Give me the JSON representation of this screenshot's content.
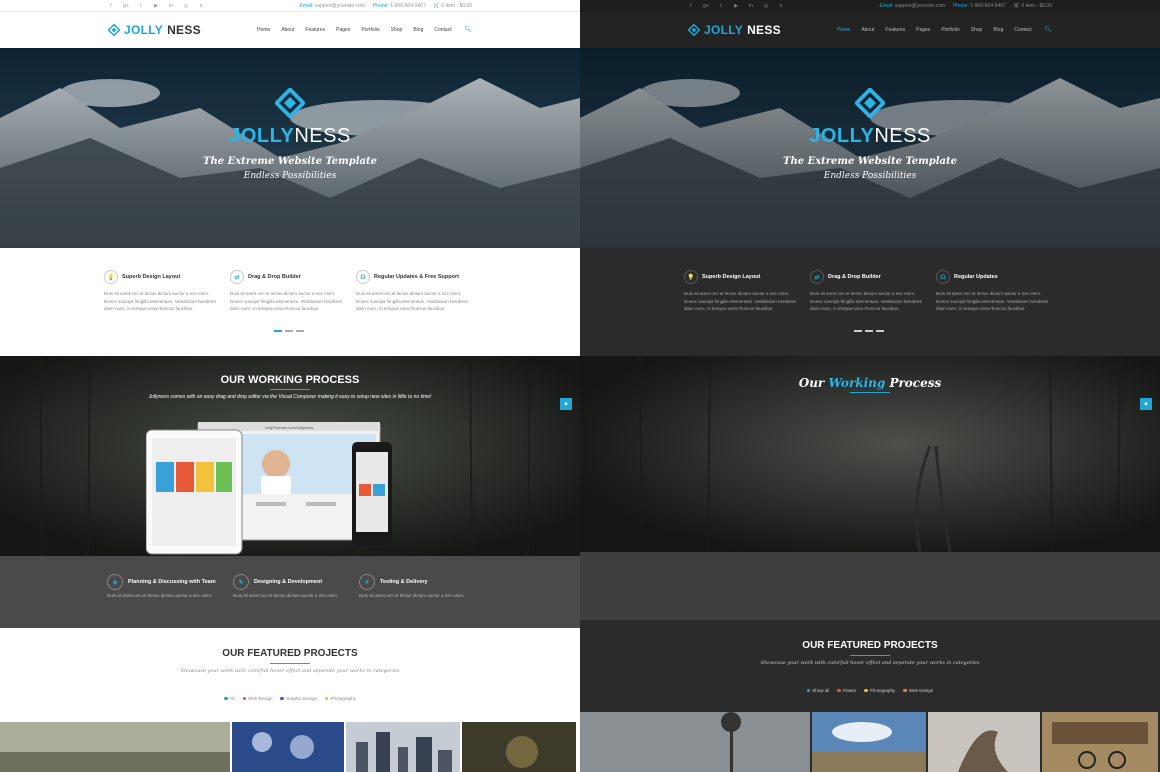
{
  "brand": {
    "part1": "JOLLY",
    "part2": "NESS"
  },
  "topbar": {
    "social_icons": [
      "facebook-icon",
      "google-plus-icon",
      "twitter-icon",
      "youtube-icon",
      "linkedin-icon",
      "instagram-icon",
      "skype-icon"
    ],
    "social_glyphs": [
      "f",
      "g+",
      "t",
      "▶",
      "in",
      "◎",
      "s"
    ],
    "email_label": "Email:",
    "email": "support@yoursite.com",
    "phone_label": "Phone:",
    "phone": "1-900-504-9467",
    "cart": "0 item - $0.00"
  },
  "nav": [
    "Home",
    "About",
    "Features",
    "Pages",
    "Portfolio",
    "Shop",
    "Blog",
    "Contact"
  ],
  "hero": {
    "tagline": "The Extreme Website Template",
    "subtitle": "Endless Possibilities"
  },
  "features_light": [
    {
      "title": "Superb Design Layout",
      "icon": "lightbulb-icon",
      "glyph": "💡",
      "text": "Duis sit amet orci et lectus dictum auctor a nec enim. Donec suscipit fringilla elementum. Vestibulum hendrerit diam nunc, in tempus urna rhoncus faucibus."
    },
    {
      "title": "Drag & Drop Builder",
      "icon": "drag-drop-icon",
      "glyph": "⇄",
      "text": "Duis sit amet orci et lectus dictum auctor a nec enim. Donec suscipit fringilla elementum. Vestibulum hendrerit diam nunc, in tempus urna rhoncus faucibus."
    },
    {
      "title": "Regular Updates & Free Support",
      "icon": "headset-icon",
      "glyph": "☊",
      "text": "Duis sit amet orci et lectus dictum auctor a nec enim. Donec suscipit fringilla elementum. Vestibulum hendrerit diam nunc, in tempus urna rhoncus faucibus."
    }
  ],
  "features_dark": [
    {
      "title": "Superb Design Layout",
      "icon": "lightbulb-icon",
      "glyph": "💡",
      "text": "Duis sit amet orci et lectus dictum auctor a nec enim. Donec suscipit fringilla elementum. Vestibulum hendrerit diam nunc, in tempus urna rhoncus faucibus."
    },
    {
      "title": "Drag & Drop Builder",
      "icon": "drag-drop-icon",
      "glyph": "⇄",
      "text": "Duis sit amet orci et lectus dictum auctor a nec enim. Donec suscipit fringilla elementum. Vestibulum hendrerit diam nunc, in tempus urna rhoncus faucibus."
    },
    {
      "title": "Regular Updates",
      "icon": "headset-icon",
      "glyph": "☊",
      "text": "Duis sit amet orci et lectus dictum auctor a nec enim. Donec suscipit fringilla elementum. Vestibulum hendrerit diam nunc, in tempus urna rhoncus faucibus."
    }
  ],
  "process_light": {
    "title": "OUR WORKING PROCESS",
    "description": "Jollyness comes with an easy drag and drop editor via the Visual Composer making it easy to setup new sites in little to no time!",
    "browser_url": "JollyThemes.com/Jollyness"
  },
  "process_dark": {
    "title_pre": "Our",
    "title_hl": "Working",
    "title_post": "Process"
  },
  "steps": [
    {
      "title": "Planning & Discussing with Team",
      "icon": "compass-icon",
      "glyph": "◈",
      "text": "Duis sit amet orci et lectus dictum auctor a nec enim."
    },
    {
      "title": "Designing & Development",
      "icon": "pencil-icon",
      "glyph": "✎",
      "text": "Duis sit amet orci et lectus dictum auctor a nec enim."
    },
    {
      "title": "Testing & Delivery",
      "icon": "delivery-icon",
      "glyph": "✈",
      "text": "Duis sit amet orci et lectus dictum auctor a nec enim."
    }
  ],
  "featured": {
    "title": "OUR FEATURED PROJECTS",
    "description": "Showcase your work with colorfull hover effect and seperate your works in categories",
    "filters_light": [
      {
        "label": "All",
        "color": "#1ea7d7"
      },
      {
        "label": "Web Design",
        "color": "#e85a2a"
      },
      {
        "label": "Graphic Design",
        "color": "#7a3fc0"
      },
      {
        "label": "Photography",
        "color": "#e6c21a"
      }
    ],
    "filters_dark": [
      {
        "label": "Show all",
        "color": "#1ea7d7"
      },
      {
        "label": "Flower",
        "color": "#e85a2a"
      },
      {
        "label": "Photography",
        "color": "#e6c21a"
      },
      {
        "label": "Web Design",
        "color": "#e8852a"
      }
    ]
  },
  "colors": {
    "accent": "#1ea7d7",
    "dark_bg": "#2b2b2b"
  }
}
